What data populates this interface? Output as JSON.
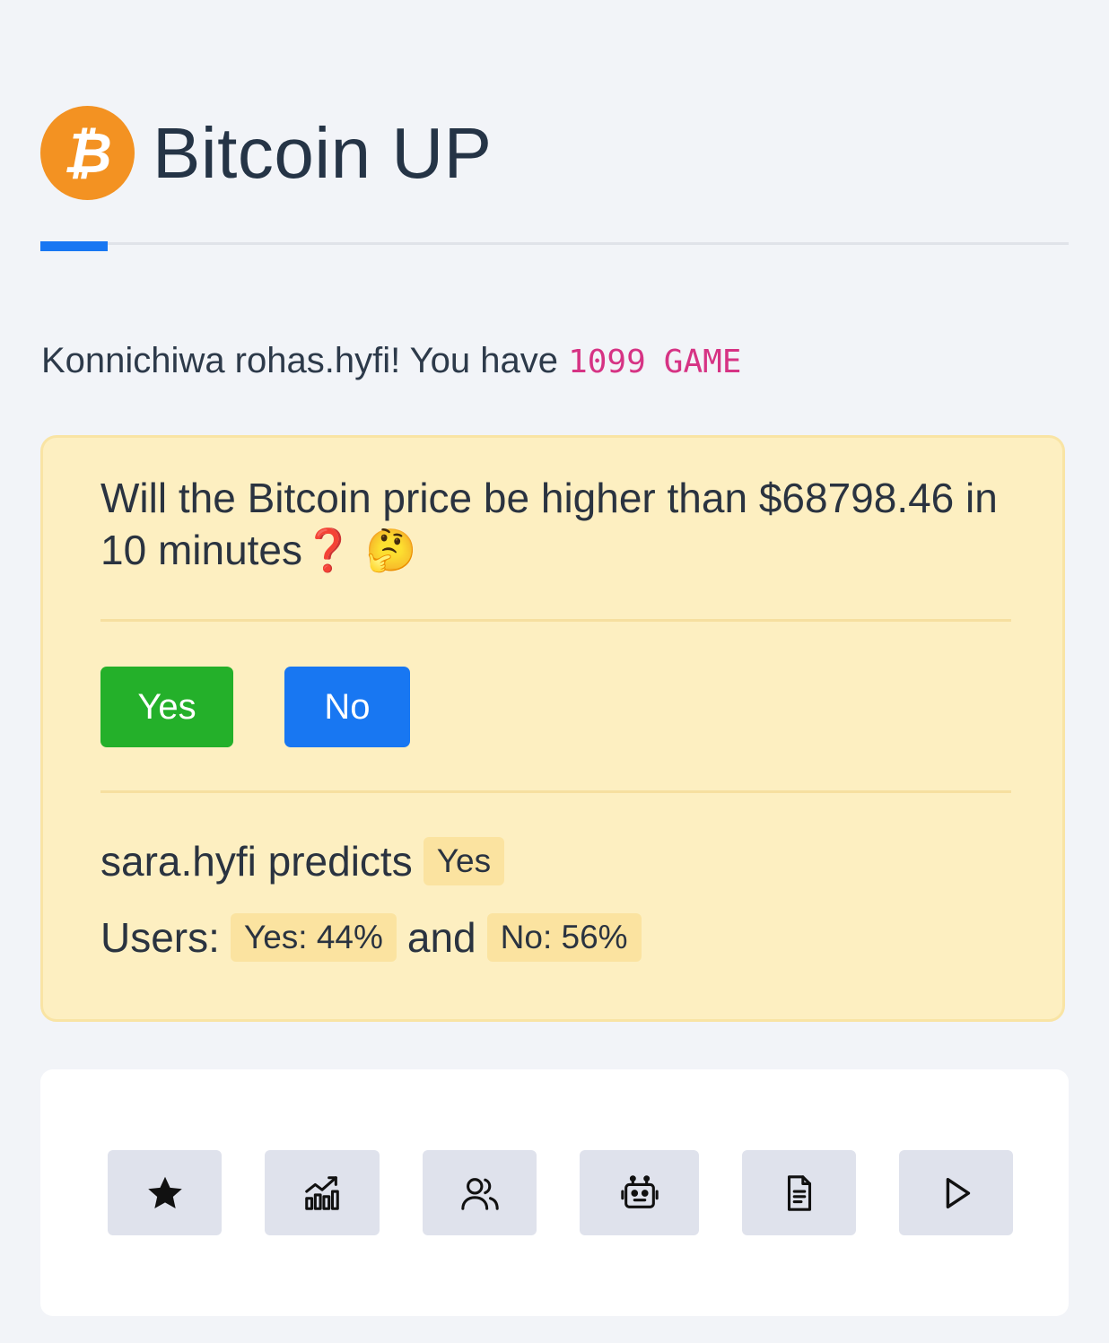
{
  "header": {
    "logo_symbol": "₿",
    "title": "Bitcoin UP"
  },
  "greeting": {
    "text": "Konnichiwa rohas.hyfi! You have ",
    "balance": "1099",
    "currency": "GAME"
  },
  "question": {
    "text": "Will the Bitcoin price be higher than $68798.46 in 10 minutes",
    "question_emoji": "❓",
    "thinking_emoji": "🤔",
    "yes_label": "Yes",
    "no_label": "No"
  },
  "prediction": {
    "predictor": "sara.hyfi predicts",
    "predicted_value": "Yes"
  },
  "users": {
    "label": "Users:",
    "yes_stat": "Yes: 44%",
    "connector": "and",
    "no_stat": "No: 56%"
  },
  "toolbar": {
    "icons": [
      "star-icon",
      "chart-icon",
      "users-icon",
      "robot-icon",
      "document-icon",
      "play-icon"
    ]
  },
  "colors": {
    "brand_orange": "#f39222",
    "accent_blue": "#1877f2",
    "yes_green": "#24b02a",
    "balance_pink": "#d63384",
    "card_yellow": "#fdefc1"
  }
}
